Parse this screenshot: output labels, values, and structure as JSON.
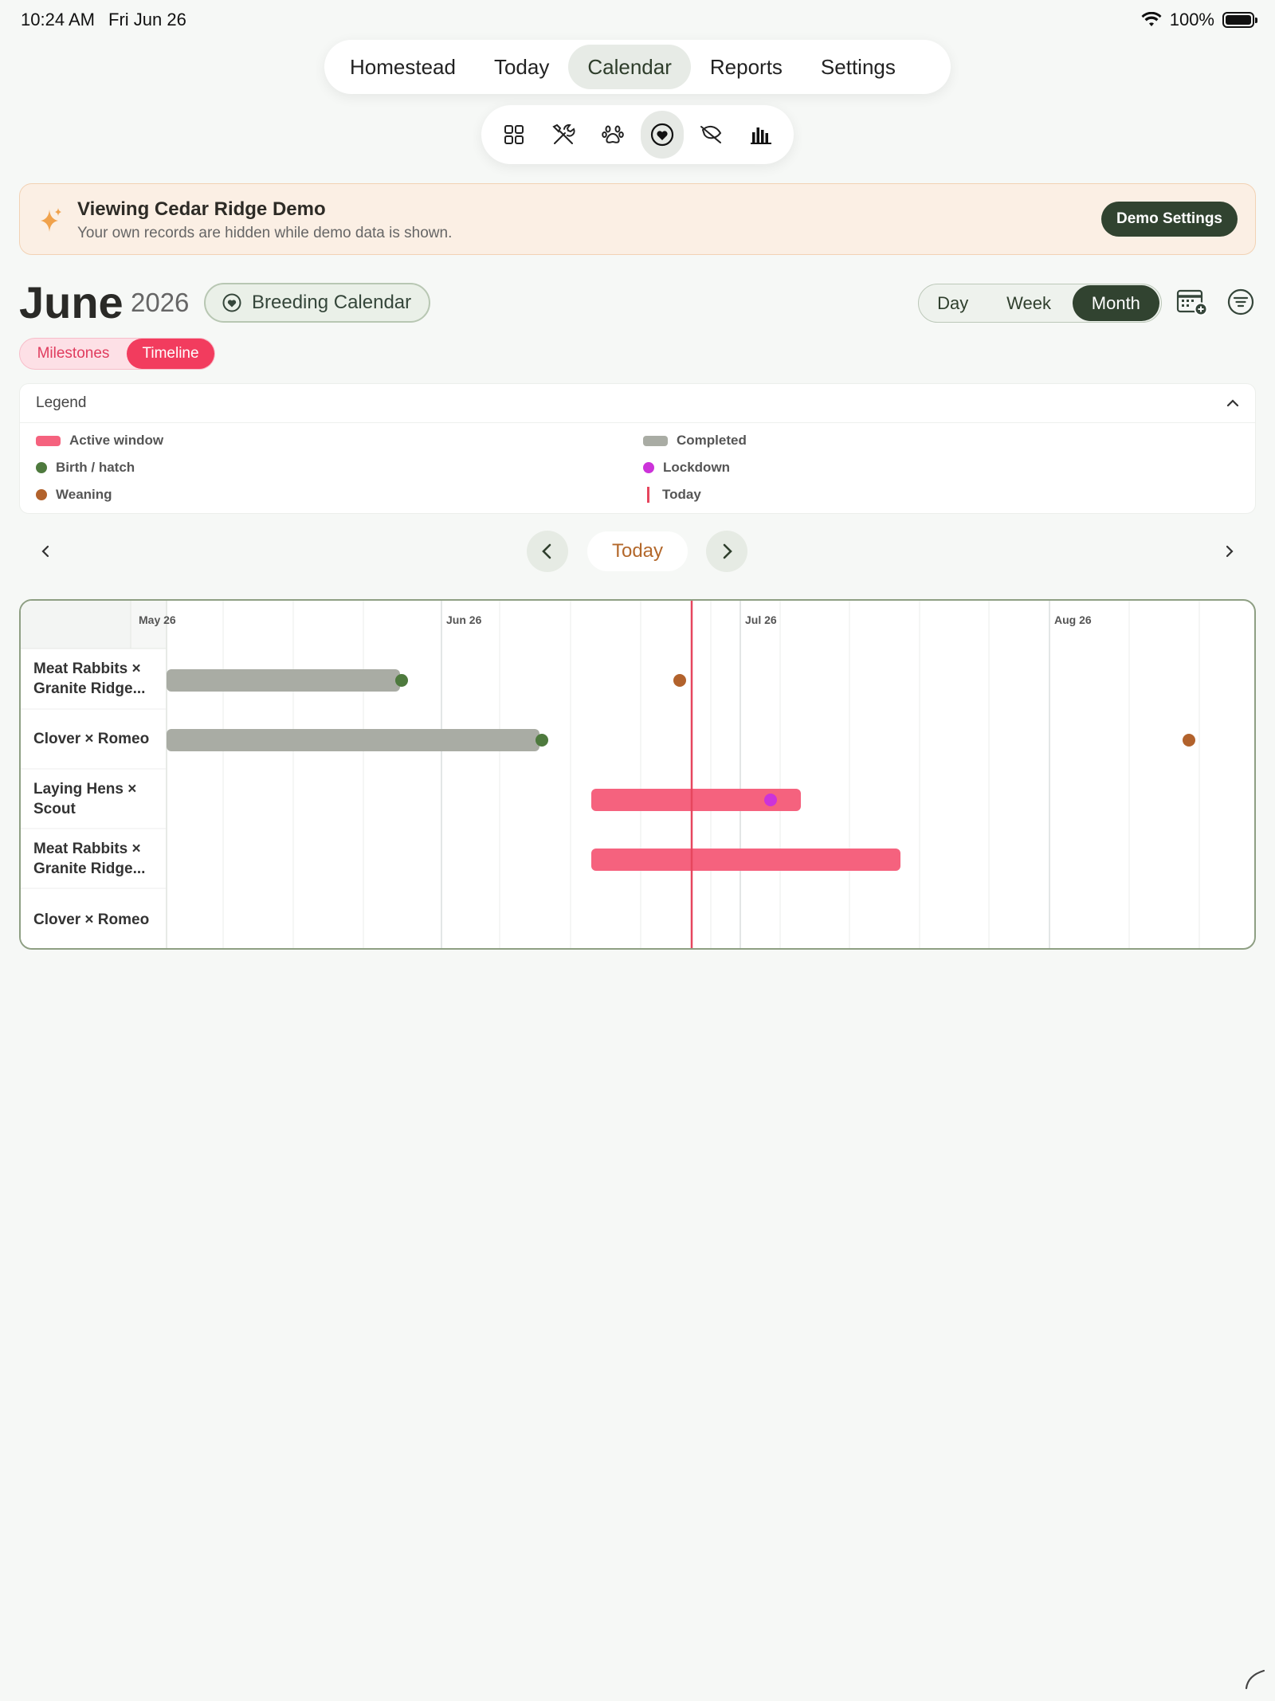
{
  "status": {
    "time": "10:24 AM",
    "date": "Fri Jun 26",
    "battery": "100%"
  },
  "nav": {
    "tabs": [
      {
        "label": "Homestead"
      },
      {
        "label": "Today"
      },
      {
        "label": "Calendar",
        "active": true
      },
      {
        "label": "Reports"
      },
      {
        "label": "Settings"
      }
    ]
  },
  "icon_bar": [
    "grid-icon",
    "tools-icon",
    "paw-icon",
    "heart-circle-icon",
    "leaf-icon",
    "bar-chart-icon"
  ],
  "banner": {
    "title": "Viewing Cedar Ridge Demo",
    "subtitle": "Your own records are hidden while demo data is shown.",
    "button": "Demo Settings"
  },
  "header": {
    "month": "June",
    "year": "2026",
    "calendar_type": "Breeding Calendar",
    "views": {
      "day": "Day",
      "week": "Week",
      "month": "Month",
      "selected": "Month"
    }
  },
  "mode_toggle": {
    "milestones": "Milestones",
    "timeline": "Timeline",
    "selected": "Timeline"
  },
  "legend": {
    "title": "Legend",
    "items": {
      "active": "Active window",
      "birth": "Birth / hatch",
      "weaning": "Weaning",
      "completed": "Completed",
      "lockdown": "Lockdown",
      "today": "Today"
    }
  },
  "navigation": {
    "today_label": "Today"
  },
  "timeline": {
    "scale_labels": [
      "May 26",
      "Jun 26",
      "Jul 26",
      "Aug 26"
    ],
    "rows": [
      {
        "label": "Meat Rabbits × Granite Ridge..."
      },
      {
        "label": "Clover × Romeo"
      },
      {
        "label": "Laying Hens × Scout"
      },
      {
        "label": "Meat Rabbits × Granite Ridge..."
      },
      {
        "label": "Clover × Romeo"
      }
    ]
  },
  "colors": {
    "accent": "#314330",
    "active": "#f5627e",
    "completed": "#a9aca4",
    "birth": "#4e7a3e",
    "weaning": "#b2622c",
    "lockdown": "#cc33d9",
    "today": "#e6465e"
  }
}
